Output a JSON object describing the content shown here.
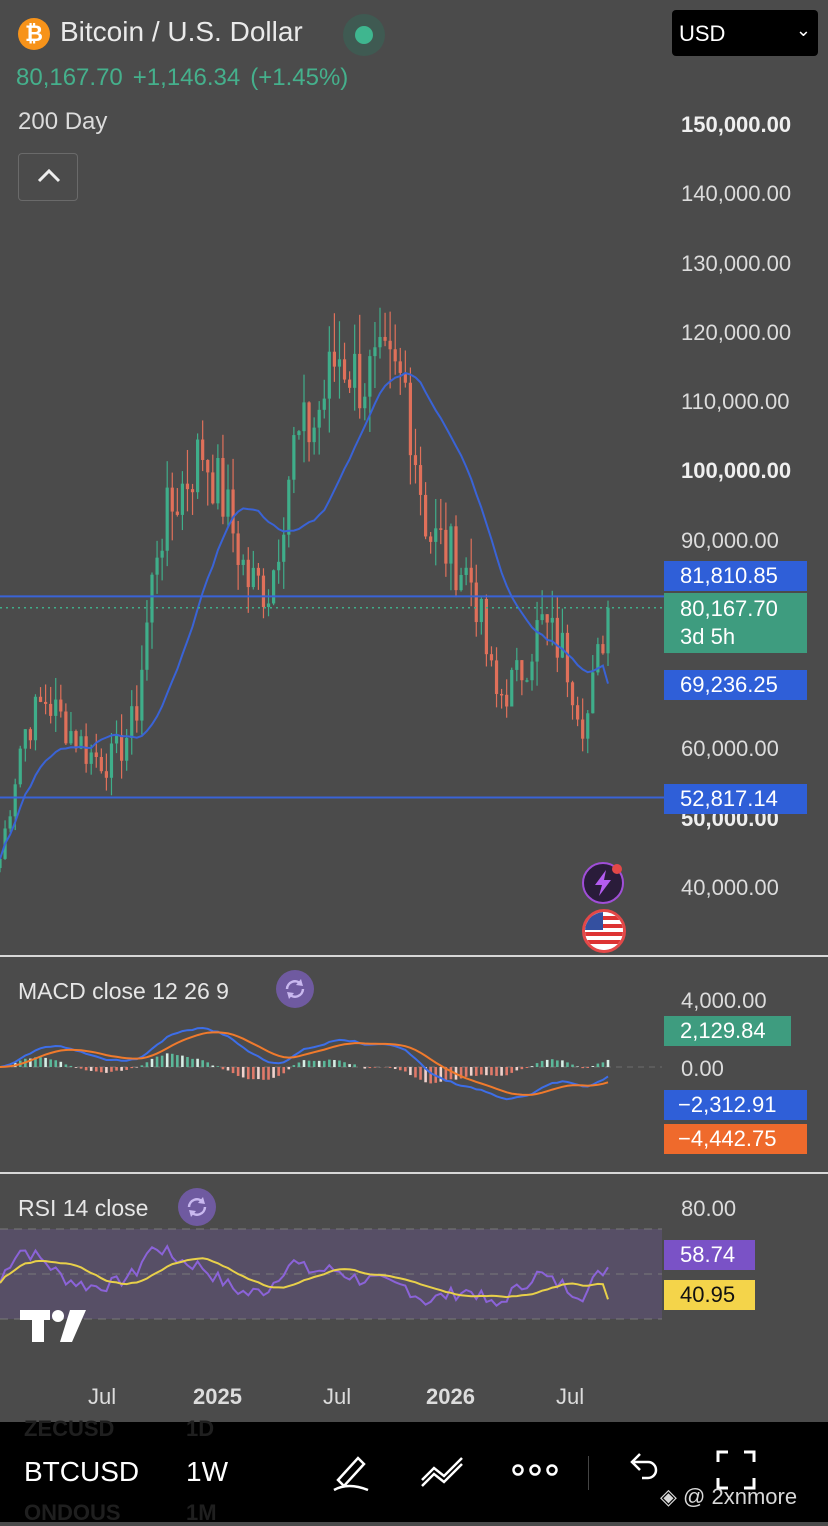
{
  "header": {
    "title": "Bitcoin / U.S. Dollar",
    "coin_symbol": "₿",
    "last_price": "80,167.70",
    "change": "+1,146.34",
    "change_pct": "(+1.45%)",
    "ma_label": "200 Day",
    "currency": "USD"
  },
  "price_axis": {
    "labels": [
      "150,000.00",
      "140,000.00",
      "130,000.00",
      "120,000.00",
      "110,000.00",
      "100,000.00",
      "90,000.00",
      "60,000.00",
      "50,000.00",
      "40,000.00"
    ]
  },
  "price_tags": {
    "resistance": "81,810.85",
    "last": "80,167.70",
    "countdown": "3d 5h",
    "ma": "69,236.25",
    "support": "52,817.14"
  },
  "macd": {
    "label": "MACD close 12 26 9",
    "axis_top": "4,000.00",
    "axis_zero": "0.00",
    "hist_tag": "2,129.84",
    "macd_tag": "−2,312.91",
    "signal_tag": "−4,442.75"
  },
  "rsi": {
    "label": "RSI 14 close",
    "axis_top": "80.00",
    "rsi_tag": "58.74",
    "ma_tag": "40.95"
  },
  "time_axis": [
    {
      "label": "Jul",
      "bold": false
    },
    {
      "label": "2025",
      "bold": true
    },
    {
      "label": "Jul",
      "bold": false
    },
    {
      "label": "2026",
      "bold": true
    },
    {
      "label": "Jul",
      "bold": false
    }
  ],
  "toolbar": {
    "symbol": "BTCUSD",
    "interval": "1W",
    "ghost_above_symbol": "ZECUSD",
    "ghost_above_interval": "1D",
    "ghost_below_symbol": "ONDOUS",
    "ghost_below_interval": "1M"
  },
  "watermark": "@ 2xnmore",
  "colors": {
    "bg": "#4b4b4b",
    "up": "#3fae8a",
    "down": "#e0705a",
    "ma_line": "#3a63d6",
    "macd_line": "#3d6ee8",
    "signal_line": "#f07a2c",
    "rsi_line": "#8b63d8",
    "rsi_ma": "#e8d04a"
  },
  "chart_data": {
    "type": "candlestick",
    "interval": "1W",
    "price_levels": {
      "resistance": 81810.85,
      "support": 52817.14,
      "last": 80167.7,
      "ma200": 69236.25
    },
    "y_range": [
      35000,
      155000
    ],
    "close_path": [
      {
        "t": "2024-04",
        "c": 44000
      },
      {
        "t": "2024-05",
        "c": 62000
      },
      {
        "t": "2024-06",
        "c": 67000
      },
      {
        "t": "2024-07",
        "c": 63000
      },
      {
        "t": "2024-08",
        "c": 59000
      },
      {
        "t": "2024-09",
        "c": 58000
      },
      {
        "t": "2024-10",
        "c": 64000
      },
      {
        "t": "2024-11",
        "c": 90000
      },
      {
        "t": "2024-12",
        "c": 97000
      },
      {
        "t": "2025-01",
        "c": 103000
      },
      {
        "t": "2025-02",
        "c": 95000
      },
      {
        "t": "2025-03",
        "c": 84000
      },
      {
        "t": "2025-04",
        "c": 83000
      },
      {
        "t": "2025-05",
        "c": 103000
      },
      {
        "t": "2025-06",
        "c": 107000
      },
      {
        "t": "2025-07",
        "c": 117000
      },
      {
        "t": "2025-08",
        "c": 113000
      },
      {
        "t": "2025-09",
        "c": 114000
      },
      {
        "t": "2025-10",
        "c": 112000
      },
      {
        "t": "2025-11",
        "c": 91000
      },
      {
        "t": "2025-12",
        "c": 88000
      },
      {
        "t": "2026-01",
        "c": 84000
      },
      {
        "t": "2026-02",
        "c": 67000
      },
      {
        "t": "2026-03",
        "c": 70000
      },
      {
        "t": "2026-04",
        "c": 78000
      },
      {
        "t": "2026-05",
        "c": 74000
      },
      {
        "t": "2026-06",
        "c": 63000
      },
      {
        "t": "2026-07",
        "c": 80167.7
      }
    ]
  }
}
